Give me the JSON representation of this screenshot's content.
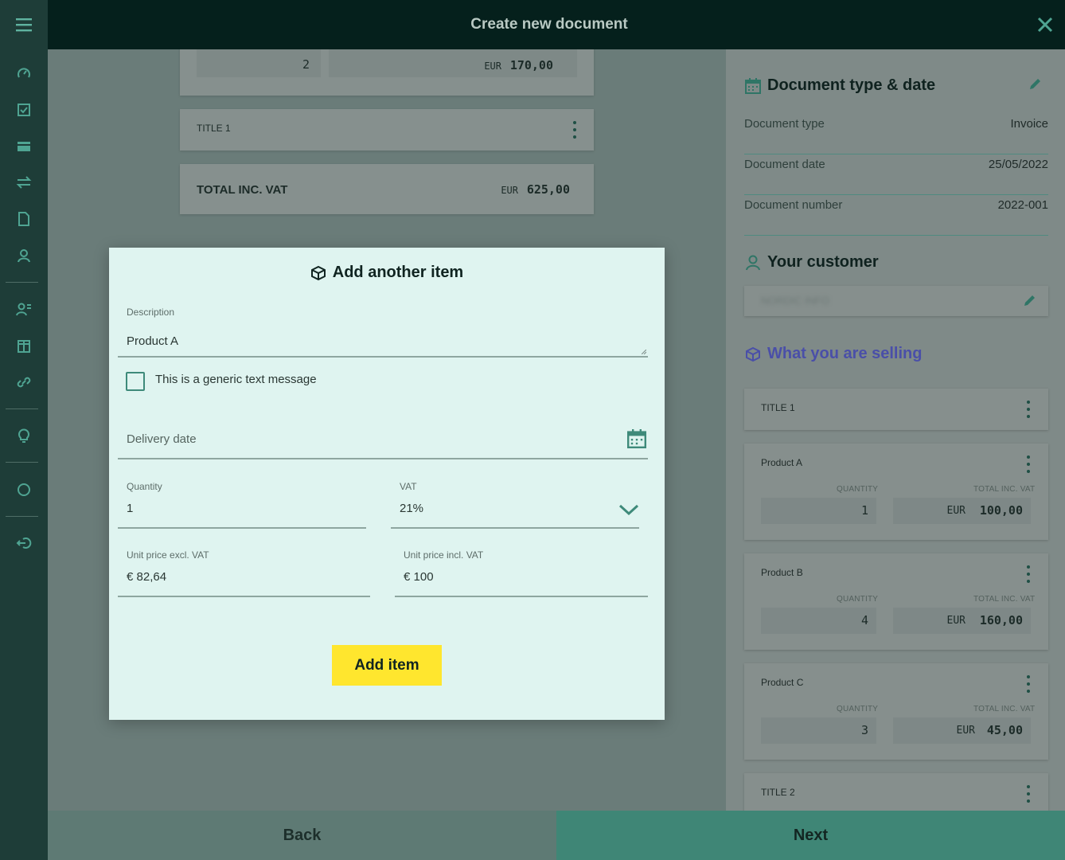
{
  "header": {
    "title": "Create new document"
  },
  "sidebar": {
    "icons": [
      "dashboard-icon",
      "checkbox-icon",
      "card-icon",
      "transfer-icon",
      "document-icon",
      "contacts-icon",
      "users-list-icon",
      "package-icon",
      "link-icon",
      "lightbulb-icon",
      "circle-icon",
      "logout-icon"
    ]
  },
  "background": {
    "row_quantity": "2",
    "row_currency": "EUR",
    "row_amount": "170,00",
    "title_card": "TITLE 1",
    "total_label": "TOTAL INC. VAT",
    "total_currency": "EUR",
    "total_amount": "625,00"
  },
  "panel": {
    "doc_section_title": "Document type & date",
    "rows": [
      {
        "label": "Document type",
        "value": "Invoice"
      },
      {
        "label": "Document date",
        "value": "25/05/2022"
      },
      {
        "label": "Document number",
        "value": "2022-001"
      }
    ],
    "customer_title": "Your customer",
    "customer_name": "NORDIC INFO",
    "selling_title": "What you are selling",
    "title1": "TITLE 1",
    "title2": "TITLE 2",
    "qty_label": "QUANTITY",
    "total_label": "TOTAL INC. VAT",
    "currency": "EUR",
    "products": [
      {
        "name": "Product A",
        "quantity": "1",
        "amount": "100,00"
      },
      {
        "name": "Product B",
        "quantity": "4",
        "amount": "160,00"
      },
      {
        "name": "Product C",
        "quantity": "3",
        "amount": "45,00"
      }
    ]
  },
  "modal": {
    "title": "Add another item",
    "description_label": "Description",
    "description_value": "Product A",
    "checkbox_label": "This is a generic text message",
    "delivery_placeholder": "Delivery date",
    "quantity_label": "Quantity",
    "quantity_value": "1",
    "vat_label": "VAT",
    "vat_value": "21%",
    "unit_excl_label": "Unit price excl. VAT",
    "unit_excl_value": "€ 82,64",
    "unit_incl_label": "Unit price incl. VAT",
    "unit_incl_value": "€ 100",
    "add_button": "Add item"
  },
  "footer": {
    "back": "Back",
    "next": "Next"
  },
  "colors": {
    "accent": "#3f8676",
    "button_yellow": "#ffe62e",
    "modal_bg": "#dff4f0",
    "selling_purple": "#4a4fa8"
  }
}
